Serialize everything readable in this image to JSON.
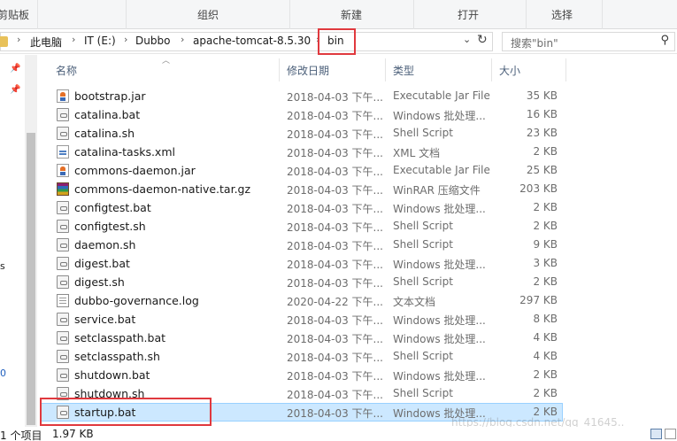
{
  "ribbon": {
    "groups": [
      "剪贴板",
      "组织",
      "新建",
      "打开",
      "选择"
    ]
  },
  "address": {
    "crumbs": [
      "此电脑",
      "IT (E:)",
      "Dubbo",
      "apache-tomcat-8.5.30",
      "bin"
    ],
    "dropdown_icon": "chevron-down-icon",
    "refresh_icon": "refresh-icon"
  },
  "search": {
    "placeholder": "搜索\"bin\"",
    "icon": "search-icon"
  },
  "nav": {
    "fragments": [
      "s",
      "0"
    ]
  },
  "columns": {
    "name": "名称",
    "date": "修改日期",
    "type": "类型",
    "size": "大小"
  },
  "files": [
    {
      "name": "bootstrap.jar",
      "date": "2018-04-03 下午...",
      "type": "Executable Jar File",
      "size": "35 KB",
      "icon": "jar"
    },
    {
      "name": "catalina.bat",
      "date": "2018-04-03 下午...",
      "type": "Windows 批处理...",
      "size": "16 KB",
      "icon": "generic"
    },
    {
      "name": "catalina.sh",
      "date": "2018-04-03 下午...",
      "type": "Shell Script",
      "size": "23 KB",
      "icon": "generic"
    },
    {
      "name": "catalina-tasks.xml",
      "date": "2018-04-03 下午...",
      "type": "XML 文档",
      "size": "2 KB",
      "icon": "xml"
    },
    {
      "name": "commons-daemon.jar",
      "date": "2018-04-03 下午...",
      "type": "Executable Jar File",
      "size": "25 KB",
      "icon": "jar"
    },
    {
      "name": "commons-daemon-native.tar.gz",
      "date": "2018-04-03 下午...",
      "type": "WinRAR 压缩文件",
      "size": "203 KB",
      "icon": "rar"
    },
    {
      "name": "configtest.bat",
      "date": "2018-04-03 下午...",
      "type": "Windows 批处理...",
      "size": "2 KB",
      "icon": "generic"
    },
    {
      "name": "configtest.sh",
      "date": "2018-04-03 下午...",
      "type": "Shell Script",
      "size": "2 KB",
      "icon": "generic"
    },
    {
      "name": "daemon.sh",
      "date": "2018-04-03 下午...",
      "type": "Shell Script",
      "size": "9 KB",
      "icon": "generic"
    },
    {
      "name": "digest.bat",
      "date": "2018-04-03 下午...",
      "type": "Windows 批处理...",
      "size": "3 KB",
      "icon": "generic"
    },
    {
      "name": "digest.sh",
      "date": "2018-04-03 下午...",
      "type": "Shell Script",
      "size": "2 KB",
      "icon": "generic"
    },
    {
      "name": "dubbo-governance.log",
      "date": "2020-04-22 下午...",
      "type": "文本文档",
      "size": "297 KB",
      "icon": "log"
    },
    {
      "name": "service.bat",
      "date": "2018-04-03 下午...",
      "type": "Windows 批处理...",
      "size": "8 KB",
      "icon": "generic"
    },
    {
      "name": "setclasspath.bat",
      "date": "2018-04-03 下午...",
      "type": "Windows 批处理...",
      "size": "4 KB",
      "icon": "generic"
    },
    {
      "name": "setclasspath.sh",
      "date": "2018-04-03 下午...",
      "type": "Shell Script",
      "size": "4 KB",
      "icon": "generic"
    },
    {
      "name": "shutdown.bat",
      "date": "2018-04-03 下午...",
      "type": "Windows 批处理...",
      "size": "2 KB",
      "icon": "generic"
    },
    {
      "name": "shutdown.sh",
      "date": "2018-04-03 下午...",
      "type": "Shell Script",
      "size": "2 KB",
      "icon": "generic"
    },
    {
      "name": "startup.bat",
      "date": "2018-04-03 下午...",
      "type": "Windows 批处理...",
      "size": "2 KB",
      "icon": "generic",
      "selected": true
    }
  ],
  "status": {
    "items": "1 个项目",
    "selection": "1.97 KB"
  },
  "watermark": "https://blog.csdn.net/qq_41645..",
  "colors": {
    "highlight_box": "#e0393e",
    "selection_bg": "#cce8ff",
    "header_text": "#4c607a"
  }
}
